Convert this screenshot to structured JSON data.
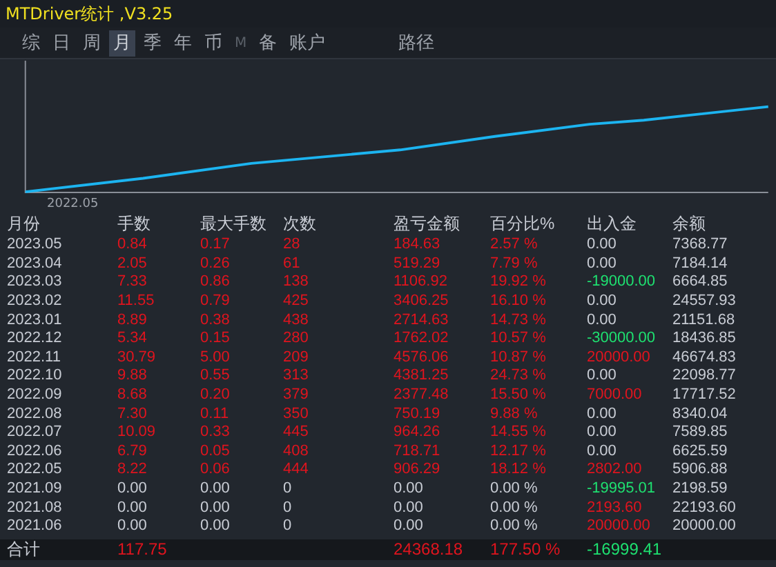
{
  "window": {
    "title": "MTDriver统计 ,V3.25"
  },
  "tabs": [
    {
      "label": "综",
      "selected": false,
      "disabled": false
    },
    {
      "label": "日",
      "selected": false,
      "disabled": false
    },
    {
      "label": "周",
      "selected": false,
      "disabled": false
    },
    {
      "label": "月",
      "selected": true,
      "disabled": false
    },
    {
      "label": "季",
      "selected": false,
      "disabled": false
    },
    {
      "label": "年",
      "selected": false,
      "disabled": false
    },
    {
      "label": "币",
      "selected": false,
      "disabled": false
    },
    {
      "label": "M",
      "selected": false,
      "disabled": true
    },
    {
      "label": "备",
      "selected": false,
      "disabled": false
    },
    {
      "label": "账户",
      "selected": false,
      "disabled": false
    }
  ],
  "path_tab": {
    "label": "路径"
  },
  "chart": {
    "x_label": "2022.05"
  },
  "table": {
    "columns": [
      "月份",
      "手数",
      "最大手数",
      "次数",
      "盈亏金额",
      "百分比%",
      "出入金",
      "余额"
    ],
    "rows": [
      [
        {
          "text": "2023.05",
          "color": "#c8ccd4"
        },
        {
          "text": "0.84",
          "color": "#e0141e"
        },
        {
          "text": "0.17",
          "color": "#e0141e"
        },
        {
          "text": "28",
          "color": "#e0141e"
        },
        {
          "text": "184.63",
          "color": "#e0141e"
        },
        {
          "text": "2.57 %",
          "color": "#e0141e"
        },
        {
          "text": "0.00",
          "color": "#c8ccd4"
        },
        {
          "text": "7368.77",
          "color": "#c8ccd4"
        }
      ],
      [
        {
          "text": "2023.04",
          "color": "#c8ccd4"
        },
        {
          "text": "2.05",
          "color": "#e0141e"
        },
        {
          "text": "0.26",
          "color": "#e0141e"
        },
        {
          "text": "61",
          "color": "#e0141e"
        },
        {
          "text": "519.29",
          "color": "#e0141e"
        },
        {
          "text": "7.79 %",
          "color": "#e0141e"
        },
        {
          "text": "0.00",
          "color": "#c8ccd4"
        },
        {
          "text": "7184.14",
          "color": "#c8ccd4"
        }
      ],
      [
        {
          "text": "2023.03",
          "color": "#c8ccd4"
        },
        {
          "text": "7.33",
          "color": "#e0141e"
        },
        {
          "text": "0.86",
          "color": "#e0141e"
        },
        {
          "text": "138",
          "color": "#e0141e"
        },
        {
          "text": "1106.92",
          "color": "#e0141e"
        },
        {
          "text": "19.92 %",
          "color": "#e0141e"
        },
        {
          "text": "-19000.00",
          "color": "#1ee070"
        },
        {
          "text": "6664.85",
          "color": "#c8ccd4"
        }
      ],
      [
        {
          "text": "2023.02",
          "color": "#c8ccd4"
        },
        {
          "text": "11.55",
          "color": "#e0141e"
        },
        {
          "text": "0.79",
          "color": "#e0141e"
        },
        {
          "text": "425",
          "color": "#e0141e"
        },
        {
          "text": "3406.25",
          "color": "#e0141e"
        },
        {
          "text": "16.10 %",
          "color": "#e0141e"
        },
        {
          "text": "0.00",
          "color": "#c8ccd4"
        },
        {
          "text": "24557.93",
          "color": "#c8ccd4"
        }
      ],
      [
        {
          "text": "2023.01",
          "color": "#c8ccd4"
        },
        {
          "text": "8.89",
          "color": "#e0141e"
        },
        {
          "text": "0.38",
          "color": "#e0141e"
        },
        {
          "text": "438",
          "color": "#e0141e"
        },
        {
          "text": "2714.63",
          "color": "#e0141e"
        },
        {
          "text": "14.73 %",
          "color": "#e0141e"
        },
        {
          "text": "0.00",
          "color": "#c8ccd4"
        },
        {
          "text": "21151.68",
          "color": "#c8ccd4"
        }
      ],
      [
        {
          "text": "2022.12",
          "color": "#c8ccd4"
        },
        {
          "text": "5.34",
          "color": "#e0141e"
        },
        {
          "text": "0.15",
          "color": "#e0141e"
        },
        {
          "text": "280",
          "color": "#e0141e"
        },
        {
          "text": "1762.02",
          "color": "#e0141e"
        },
        {
          "text": "10.57 %",
          "color": "#e0141e"
        },
        {
          "text": "-30000.00",
          "color": "#1ee070"
        },
        {
          "text": "18436.85",
          "color": "#c8ccd4"
        }
      ],
      [
        {
          "text": "2022.11",
          "color": "#c8ccd4"
        },
        {
          "text": "30.79",
          "color": "#e0141e"
        },
        {
          "text": "5.00",
          "color": "#e0141e"
        },
        {
          "text": "209",
          "color": "#e0141e"
        },
        {
          "text": "4576.06",
          "color": "#e0141e"
        },
        {
          "text": "10.87 %",
          "color": "#e0141e"
        },
        {
          "text": "20000.00",
          "color": "#e0141e"
        },
        {
          "text": "46674.83",
          "color": "#c8ccd4"
        }
      ],
      [
        {
          "text": "2022.10",
          "color": "#c8ccd4"
        },
        {
          "text": "9.88",
          "color": "#e0141e"
        },
        {
          "text": "0.55",
          "color": "#e0141e"
        },
        {
          "text": "313",
          "color": "#e0141e"
        },
        {
          "text": "4381.25",
          "color": "#e0141e"
        },
        {
          "text": "24.73 %",
          "color": "#e0141e"
        },
        {
          "text": "0.00",
          "color": "#c8ccd4"
        },
        {
          "text": "22098.77",
          "color": "#c8ccd4"
        }
      ],
      [
        {
          "text": "2022.09",
          "color": "#c8ccd4"
        },
        {
          "text": "8.68",
          "color": "#e0141e"
        },
        {
          "text": "0.20",
          "color": "#e0141e"
        },
        {
          "text": "379",
          "color": "#e0141e"
        },
        {
          "text": "2377.48",
          "color": "#e0141e"
        },
        {
          "text": "15.50 %",
          "color": "#e0141e"
        },
        {
          "text": "7000.00",
          "color": "#e0141e"
        },
        {
          "text": "17717.52",
          "color": "#c8ccd4"
        }
      ],
      [
        {
          "text": "2022.08",
          "color": "#c8ccd4"
        },
        {
          "text": "7.30",
          "color": "#e0141e"
        },
        {
          "text": "0.11",
          "color": "#e0141e"
        },
        {
          "text": "350",
          "color": "#e0141e"
        },
        {
          "text": "750.19",
          "color": "#e0141e"
        },
        {
          "text": "9.88 %",
          "color": "#e0141e"
        },
        {
          "text": "0.00",
          "color": "#c8ccd4"
        },
        {
          "text": "8340.04",
          "color": "#c8ccd4"
        }
      ],
      [
        {
          "text": "2022.07",
          "color": "#c8ccd4"
        },
        {
          "text": "10.09",
          "color": "#e0141e"
        },
        {
          "text": "0.33",
          "color": "#e0141e"
        },
        {
          "text": "445",
          "color": "#e0141e"
        },
        {
          "text": "964.26",
          "color": "#e0141e"
        },
        {
          "text": "14.55 %",
          "color": "#e0141e"
        },
        {
          "text": "0.00",
          "color": "#c8ccd4"
        },
        {
          "text": "7589.85",
          "color": "#c8ccd4"
        }
      ],
      [
        {
          "text": "2022.06",
          "color": "#c8ccd4"
        },
        {
          "text": "6.79",
          "color": "#e0141e"
        },
        {
          "text": "0.05",
          "color": "#e0141e"
        },
        {
          "text": "408",
          "color": "#e0141e"
        },
        {
          "text": "718.71",
          "color": "#e0141e"
        },
        {
          "text": "12.17 %",
          "color": "#e0141e"
        },
        {
          "text": "0.00",
          "color": "#c8ccd4"
        },
        {
          "text": "6625.59",
          "color": "#c8ccd4"
        }
      ],
      [
        {
          "text": "2022.05",
          "color": "#c8ccd4"
        },
        {
          "text": "8.22",
          "color": "#e0141e"
        },
        {
          "text": "0.06",
          "color": "#e0141e"
        },
        {
          "text": "444",
          "color": "#e0141e"
        },
        {
          "text": "906.29",
          "color": "#e0141e"
        },
        {
          "text": "18.12 %",
          "color": "#e0141e"
        },
        {
          "text": "2802.00",
          "color": "#e0141e"
        },
        {
          "text": "5906.88",
          "color": "#c8ccd4"
        }
      ],
      [
        {
          "text": "2021.09",
          "color": "#c8ccd4"
        },
        {
          "text": "0.00",
          "color": "#c8ccd4"
        },
        {
          "text": "0.00",
          "color": "#c8ccd4"
        },
        {
          "text": "0",
          "color": "#c8ccd4"
        },
        {
          "text": "0.00",
          "color": "#c8ccd4"
        },
        {
          "text": "0.00 %",
          "color": "#c8ccd4"
        },
        {
          "text": "-19995.01",
          "color": "#1ee070"
        },
        {
          "text": "2198.59",
          "color": "#c8ccd4"
        }
      ],
      [
        {
          "text": "2021.08",
          "color": "#c8ccd4"
        },
        {
          "text": "0.00",
          "color": "#c8ccd4"
        },
        {
          "text": "0.00",
          "color": "#c8ccd4"
        },
        {
          "text": "0",
          "color": "#c8ccd4"
        },
        {
          "text": "0.00",
          "color": "#c8ccd4"
        },
        {
          "text": "0.00 %",
          "color": "#c8ccd4"
        },
        {
          "text": "2193.60",
          "color": "#e0141e"
        },
        {
          "text": "22193.60",
          "color": "#c8ccd4"
        }
      ],
      [
        {
          "text": "2021.06",
          "color": "#c8ccd4"
        },
        {
          "text": "0.00",
          "color": "#c8ccd4"
        },
        {
          "text": "0.00",
          "color": "#c8ccd4"
        },
        {
          "text": "0",
          "color": "#c8ccd4"
        },
        {
          "text": "0.00",
          "color": "#c8ccd4"
        },
        {
          "text": "0.00 %",
          "color": "#c8ccd4"
        },
        {
          "text": "20000.00",
          "color": "#e0141e"
        },
        {
          "text": "20000.00",
          "color": "#c8ccd4"
        }
      ]
    ],
    "total": {
      "label": {
        "text": "合计",
        "color": "#c8ccd4"
      },
      "lots": {
        "text": "117.75",
        "color": "#e0141e"
      },
      "profit": {
        "text": "24368.18",
        "color": "#e0141e"
      },
      "percent": {
        "text": "177.50 %",
        "color": "#e0141e"
      },
      "flow": {
        "text": "-16999.41",
        "color": "#1ee070"
      }
    }
  }
}
